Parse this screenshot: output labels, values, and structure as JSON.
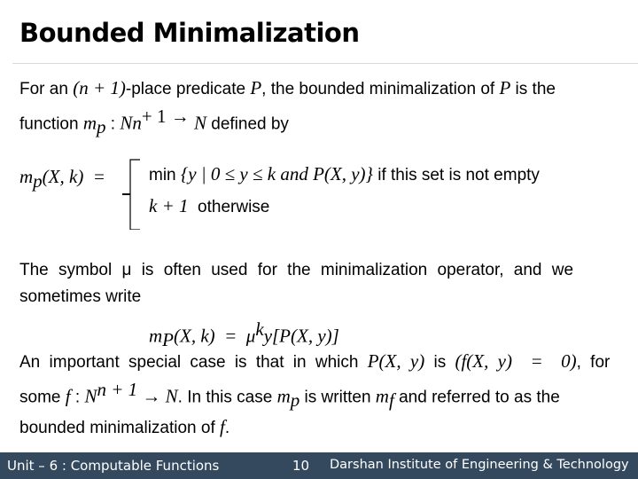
{
  "title": "Bounded Minimalization",
  "para1": {
    "t1": "For an ",
    "m1": "(n + 1)",
    "t2": "-place predicate ",
    "m2": "P",
    "t3": ", the bounded minimalization of ",
    "m3": "P",
    "t4": " is the",
    "t5": "function ",
    "m4": "m",
    "m4sub": "p",
    "t6": " : ",
    "m5": "Nn",
    "m5sup": "+ 1 →",
    "m6": " N",
    "t7": " defined by"
  },
  "definition": {
    "lhs": "m",
    "lhs_sub": "p",
    "lhs_rest": "(X, k)  =",
    "case1_t1": "min ",
    "case1_m": "{y | 0 ≤ y ≤ k and P(X, y)}",
    "case1_t2": " if this set is not empty",
    "case2_m": "k + 1",
    "case2_t": "  otherwise"
  },
  "para2": {
    "line1": "The symbol μ is often used for the minimalization operator, and we",
    "line2": "sometimes write"
  },
  "mu_formula": {
    "lhs": "m",
    "lhs_sub": "P",
    "rest1": "(X, k)  =  μ",
    "sup": "k",
    "rest2": "y[P(X, y)]"
  },
  "para3": {
    "t1": "An important special case is that in which ",
    "m1": "P(X, y)",
    "t2": " is ",
    "m2": "(f(X, y)  =  0)",
    "t3": ", for",
    "t4": "some ",
    "m3": "f",
    "t5": " : ",
    "m4": "N",
    "m4sup": "n + 1",
    "m5": " → N",
    "t6": ". In this case ",
    "m6": "m",
    "m6sub": "p",
    "t7": " is written ",
    "m7": "m",
    "m7sub": "f",
    "t8": " and referred to as the",
    "t9": "bounded minimalization of ",
    "m8": "f",
    "t10": "."
  },
  "footer": {
    "unit": "Unit – 6 : Computable Functions",
    "page": "10",
    "institute": "Darshan Institute of Engineering & Technology",
    "bg_color": "#34495e"
  }
}
